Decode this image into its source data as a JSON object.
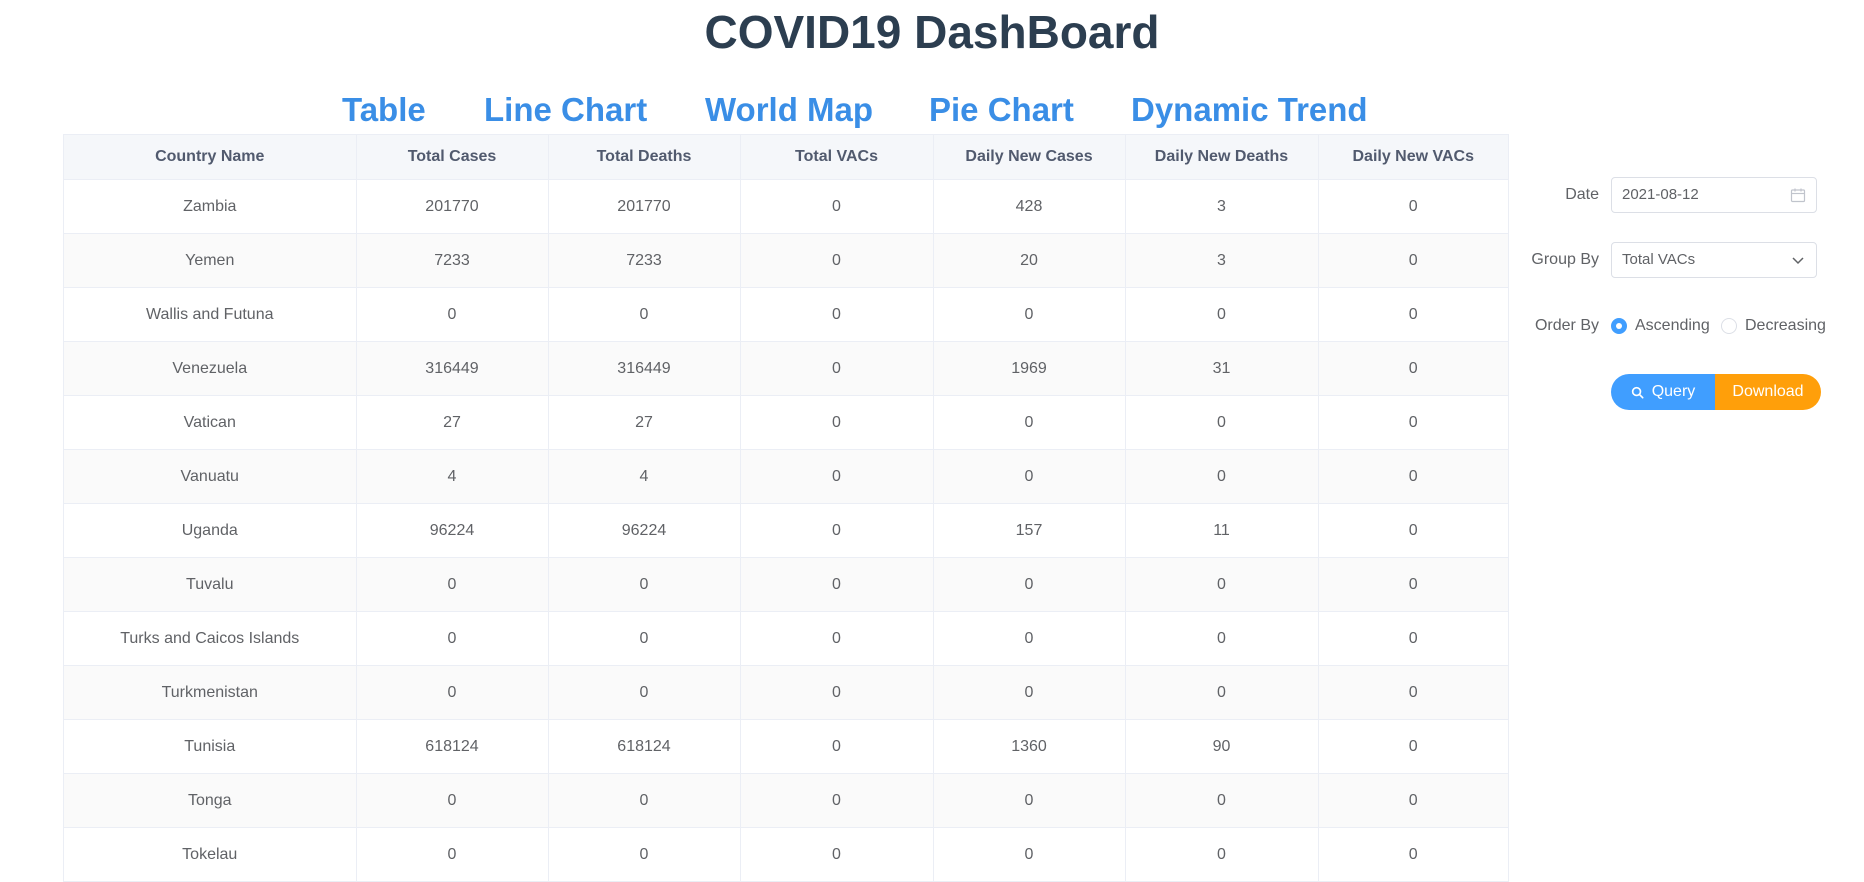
{
  "title": "COVID19 DashBoard",
  "nav": [
    "Table",
    "Line Chart",
    "World Map",
    "Pie Chart",
    "Dynamic Trend"
  ],
  "table": {
    "headers": [
      "Country Name",
      "Total Cases",
      "Total Deaths",
      "Total VACs",
      "Daily New Cases",
      "Daily New Deaths",
      "Daily New VACs"
    ],
    "rows": [
      [
        "Zambia",
        "201770",
        "201770",
        "0",
        "428",
        "3",
        "0"
      ],
      [
        "Yemen",
        "7233",
        "7233",
        "0",
        "20",
        "3",
        "0"
      ],
      [
        "Wallis and Futuna",
        "0",
        "0",
        "0",
        "0",
        "0",
        "0"
      ],
      [
        "Venezuela",
        "316449",
        "316449",
        "0",
        "1969",
        "31",
        "0"
      ],
      [
        "Vatican",
        "27",
        "27",
        "0",
        "0",
        "0",
        "0"
      ],
      [
        "Vanuatu",
        "4",
        "4",
        "0",
        "0",
        "0",
        "0"
      ],
      [
        "Uganda",
        "96224",
        "96224",
        "0",
        "157",
        "11",
        "0"
      ],
      [
        "Tuvalu",
        "0",
        "0",
        "0",
        "0",
        "0",
        "0"
      ],
      [
        "Turks and Caicos Islands",
        "0",
        "0",
        "0",
        "0",
        "0",
        "0"
      ],
      [
        "Turkmenistan",
        "0",
        "0",
        "0",
        "0",
        "0",
        "0"
      ],
      [
        "Tunisia",
        "618124",
        "618124",
        "0",
        "1360",
        "90",
        "0"
      ],
      [
        "Tonga",
        "0",
        "0",
        "0",
        "0",
        "0",
        "0"
      ],
      [
        "Tokelau",
        "0",
        "0",
        "0",
        "0",
        "0",
        "0"
      ]
    ]
  },
  "form": {
    "date_label": "Date",
    "date_value": "2021-08-12",
    "group_label": "Group By",
    "group_value": "Total VACs",
    "order_label": "Order By",
    "order_options": [
      "Ascending",
      "Decreasing"
    ],
    "order_selected": "Ascending",
    "query_label": "Query",
    "download_label": "Download"
  },
  "colors": {
    "nav": "#3a8ee6",
    "primary": "#409eff",
    "download": "#ff9f0a",
    "title": "#2c3e50"
  },
  "icons": {
    "date": "calendar-icon",
    "group": "chevron-down-icon",
    "query": "search-icon"
  }
}
